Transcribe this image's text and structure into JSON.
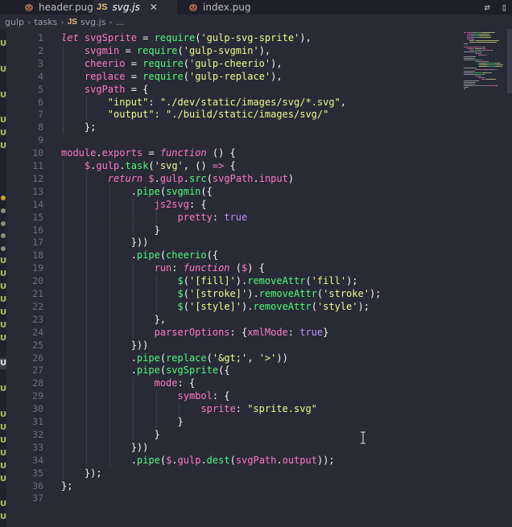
{
  "tabs": [
    {
      "icon": "pug-icon",
      "label": "header.pug",
      "active": false
    },
    {
      "icon": "js-icon",
      "label": "svg.js",
      "active": true
    },
    {
      "icon": "pug-icon",
      "label": "index.pug",
      "active": false
    }
  ],
  "js_icon_text": "JS",
  "breadcrumb": [
    "gulp",
    "tasks",
    "svg.js",
    "..."
  ],
  "editor": {
    "lines": [
      {
        "n": "1",
        "t": [
          [
            "kw",
            "let"
          ],
          [
            "plain",
            " "
          ],
          [
            "id",
            "svgSprite"
          ],
          [
            "plain",
            " = "
          ],
          [
            "fn",
            "require"
          ],
          [
            "plain",
            "("
          ],
          [
            "str",
            "'gulp-svg-sprite'"
          ],
          [
            "plain",
            "),"
          ]
        ]
      },
      {
        "n": "2",
        "t": [
          [
            "plain",
            "    "
          ],
          [
            "id",
            "svgmin"
          ],
          [
            "plain",
            " = "
          ],
          [
            "fn",
            "require"
          ],
          [
            "plain",
            "("
          ],
          [
            "str",
            "'gulp-svgmin'"
          ],
          [
            "plain",
            "),"
          ]
        ]
      },
      {
        "n": "3",
        "t": [
          [
            "plain",
            "    "
          ],
          [
            "id",
            "cheerio"
          ],
          [
            "plain",
            " = "
          ],
          [
            "fn",
            "require"
          ],
          [
            "plain",
            "("
          ],
          [
            "str",
            "'gulp-cheerio'"
          ],
          [
            "plain",
            "),"
          ]
        ]
      },
      {
        "n": "4",
        "t": [
          [
            "plain",
            "    "
          ],
          [
            "id",
            "replace"
          ],
          [
            "plain",
            " = "
          ],
          [
            "fn",
            "require"
          ],
          [
            "plain",
            "("
          ],
          [
            "str",
            "'gulp-replace'"
          ],
          [
            "plain",
            "),"
          ]
        ]
      },
      {
        "n": "5",
        "t": [
          [
            "plain",
            "    "
          ],
          [
            "id",
            "svgPath"
          ],
          [
            "plain",
            " = {"
          ]
        ]
      },
      {
        "n": "6",
        "t": [
          [
            "plain",
            "        "
          ],
          [
            "str",
            "\"input\""
          ],
          [
            "plain",
            ": "
          ],
          [
            "str",
            "\"./dev/static/images/svg/*.svg\""
          ],
          [
            "plain",
            ","
          ]
        ]
      },
      {
        "n": "7",
        "t": [
          [
            "plain",
            "        "
          ],
          [
            "str",
            "\"output\""
          ],
          [
            "plain",
            ": "
          ],
          [
            "str",
            "\"./build/static/images/svg/\""
          ]
        ]
      },
      {
        "n": "8",
        "t": [
          [
            "plain",
            "    };"
          ]
        ]
      },
      {
        "n": "9",
        "t": []
      },
      {
        "n": "10",
        "t": [
          [
            "id",
            "module"
          ],
          [
            "plain",
            "."
          ],
          [
            "id",
            "exports"
          ],
          [
            "plain",
            " = "
          ],
          [
            "kw",
            "function"
          ],
          [
            "plain",
            " () {"
          ]
        ]
      },
      {
        "n": "11",
        "t": [
          [
            "plain",
            "    "
          ],
          [
            "id",
            "$"
          ],
          [
            "plain",
            "."
          ],
          [
            "id",
            "gulp"
          ],
          [
            "plain",
            "."
          ],
          [
            "fn",
            "task"
          ],
          [
            "plain",
            "("
          ],
          [
            "str",
            "'svg'"
          ],
          [
            "plain",
            ", () "
          ],
          [
            "kw",
            "=>"
          ],
          [
            "plain",
            " {"
          ]
        ]
      },
      {
        "n": "12",
        "t": [
          [
            "plain",
            "        "
          ],
          [
            "kw",
            "return"
          ],
          [
            "plain",
            " "
          ],
          [
            "id",
            "$"
          ],
          [
            "plain",
            "."
          ],
          [
            "id",
            "gulp"
          ],
          [
            "plain",
            "."
          ],
          [
            "fn",
            "src"
          ],
          [
            "plain",
            "("
          ],
          [
            "id",
            "svgPath"
          ],
          [
            "plain",
            "."
          ],
          [
            "id",
            "input"
          ],
          [
            "plain",
            ")"
          ]
        ]
      },
      {
        "n": "13",
        "t": [
          [
            "plain",
            "            ."
          ],
          [
            "fn",
            "pipe"
          ],
          [
            "plain",
            "("
          ],
          [
            "fn",
            "svgmin"
          ],
          [
            "plain",
            "({"
          ]
        ]
      },
      {
        "n": "14",
        "t": [
          [
            "plain",
            "                "
          ],
          [
            "prop",
            "js2svg"
          ],
          [
            "plain",
            ": {"
          ]
        ]
      },
      {
        "n": "15",
        "t": [
          [
            "plain",
            "                    "
          ],
          [
            "prop",
            "pretty"
          ],
          [
            "plain",
            ": "
          ],
          [
            "bool",
            "true"
          ]
        ]
      },
      {
        "n": "16",
        "t": [
          [
            "plain",
            "                }"
          ]
        ]
      },
      {
        "n": "17",
        "t": [
          [
            "plain",
            "            }))"
          ]
        ]
      },
      {
        "n": "18",
        "t": [
          [
            "plain",
            "            ."
          ],
          [
            "fn",
            "pipe"
          ],
          [
            "plain",
            "("
          ],
          [
            "fn",
            "cheerio"
          ],
          [
            "plain",
            "({"
          ]
        ]
      },
      {
        "n": "19",
        "t": [
          [
            "plain",
            "                "
          ],
          [
            "prop",
            "run"
          ],
          [
            "plain",
            ": "
          ],
          [
            "kw",
            "function"
          ],
          [
            "plain",
            " ("
          ],
          [
            "id",
            "$"
          ],
          [
            "plain",
            ") {"
          ]
        ]
      },
      {
        "n": "20",
        "t": [
          [
            "plain",
            "                    "
          ],
          [
            "fn",
            "$"
          ],
          [
            "plain",
            "("
          ],
          [
            "str",
            "'[fill]'"
          ],
          [
            "plain",
            ")."
          ],
          [
            "fn",
            "removeAttr"
          ],
          [
            "plain",
            "("
          ],
          [
            "str",
            "'fill'"
          ],
          [
            "plain",
            ");"
          ]
        ]
      },
      {
        "n": "21",
        "t": [
          [
            "plain",
            "                    "
          ],
          [
            "fn",
            "$"
          ],
          [
            "plain",
            "("
          ],
          [
            "str",
            "'[stroke]'"
          ],
          [
            "plain",
            ")."
          ],
          [
            "fn",
            "removeAttr"
          ],
          [
            "plain",
            "("
          ],
          [
            "str",
            "'stroke'"
          ],
          [
            "plain",
            ");"
          ]
        ]
      },
      {
        "n": "22",
        "t": [
          [
            "plain",
            "                    "
          ],
          [
            "fn",
            "$"
          ],
          [
            "plain",
            "("
          ],
          [
            "str",
            "'[style]'"
          ],
          [
            "plain",
            ")."
          ],
          [
            "fn",
            "removeAttr"
          ],
          [
            "plain",
            "("
          ],
          [
            "str",
            "'style'"
          ],
          [
            "plain",
            ");"
          ]
        ]
      },
      {
        "n": "23",
        "t": [
          [
            "plain",
            "                },"
          ]
        ]
      },
      {
        "n": "24",
        "t": [
          [
            "plain",
            "                "
          ],
          [
            "prop",
            "parserOptions"
          ],
          [
            "plain",
            ": {"
          ],
          [
            "prop",
            "xmlMode"
          ],
          [
            "plain",
            ": "
          ],
          [
            "bool",
            "true"
          ],
          [
            "plain",
            "}"
          ]
        ]
      },
      {
        "n": "25",
        "t": [
          [
            "plain",
            "            }))"
          ]
        ]
      },
      {
        "n": "26",
        "t": [
          [
            "plain",
            "            ."
          ],
          [
            "fn",
            "pipe"
          ],
          [
            "plain",
            "("
          ],
          [
            "fn",
            "replace"
          ],
          [
            "plain",
            "("
          ],
          [
            "str",
            "'&gt;'"
          ],
          [
            "plain",
            ", "
          ],
          [
            "str",
            "'>'"
          ],
          [
            "plain",
            "))"
          ]
        ]
      },
      {
        "n": "27",
        "t": [
          [
            "plain",
            "            ."
          ],
          [
            "fn",
            "pipe"
          ],
          [
            "plain",
            "("
          ],
          [
            "fn",
            "svgSprite"
          ],
          [
            "plain",
            "({"
          ]
        ]
      },
      {
        "n": "28",
        "t": [
          [
            "plain",
            "                "
          ],
          [
            "prop",
            "mode"
          ],
          [
            "plain",
            ": {"
          ]
        ]
      },
      {
        "n": "29",
        "t": [
          [
            "plain",
            "                    "
          ],
          [
            "prop",
            "symbol"
          ],
          [
            "plain",
            ": {"
          ]
        ]
      },
      {
        "n": "30",
        "t": [
          [
            "plain",
            "                        "
          ],
          [
            "prop",
            "sprite"
          ],
          [
            "plain",
            ": "
          ],
          [
            "str",
            "\"sprite.svg\""
          ]
        ]
      },
      {
        "n": "31",
        "t": [
          [
            "plain",
            "                    }"
          ]
        ]
      },
      {
        "n": "32",
        "t": [
          [
            "plain",
            "                }"
          ]
        ]
      },
      {
        "n": "33",
        "t": [
          [
            "plain",
            "            }))"
          ]
        ]
      },
      {
        "n": "34",
        "t": [
          [
            "plain",
            "            ."
          ],
          [
            "fn",
            "pipe"
          ],
          [
            "plain",
            "("
          ],
          [
            "id",
            "$"
          ],
          [
            "plain",
            "."
          ],
          [
            "id",
            "gulp"
          ],
          [
            "plain",
            "."
          ],
          [
            "fn",
            "dest"
          ],
          [
            "plain",
            "("
          ],
          [
            "id",
            "svgPath"
          ],
          [
            "plain",
            "."
          ],
          [
            "id",
            "output"
          ],
          [
            "plain",
            "));"
          ]
        ]
      },
      {
        "n": "35",
        "t": [
          [
            "plain",
            "    });"
          ]
        ]
      },
      {
        "n": "36",
        "t": [
          [
            "plain",
            "};"
          ]
        ]
      },
      {
        "n": "37",
        "t": []
      }
    ]
  },
  "git_markers": [
    {
      "row": 1,
      "kind": "u",
      "label": "U"
    },
    {
      "row": 3,
      "kind": "u",
      "label": "U"
    },
    {
      "row": 5,
      "kind": "u",
      "label": "U"
    },
    {
      "row": 7,
      "kind": "u",
      "label": "U"
    },
    {
      "row": 8,
      "kind": "u",
      "label": "U"
    },
    {
      "row": 9,
      "kind": "u",
      "label": "U"
    },
    {
      "row": 13,
      "kind": "dot-yellow",
      "label": ""
    },
    {
      "row": 14,
      "kind": "dot",
      "label": ""
    },
    {
      "row": 15,
      "kind": "dot",
      "label": ""
    },
    {
      "row": 16,
      "kind": "dot",
      "label": ""
    },
    {
      "row": 17,
      "kind": "dot",
      "label": ""
    },
    {
      "row": 18,
      "kind": "u",
      "label": "U"
    },
    {
      "row": 19,
      "kind": "u",
      "label": "U"
    },
    {
      "row": 20,
      "kind": "u",
      "label": "U"
    },
    {
      "row": 21,
      "kind": "u",
      "label": "U"
    },
    {
      "row": 22,
      "kind": "u",
      "label": "U"
    },
    {
      "row": 23,
      "kind": "u",
      "label": "U"
    },
    {
      "row": 24,
      "kind": "u",
      "label": "U"
    },
    {
      "row": 26,
      "kind": "hl",
      "label": "U"
    },
    {
      "row": 28,
      "kind": "u",
      "label": "U"
    },
    {
      "row": 30,
      "kind": "u",
      "label": "U"
    },
    {
      "row": 31,
      "kind": "u",
      "label": "U"
    },
    {
      "row": 32,
      "kind": "u",
      "label": "U"
    },
    {
      "row": 33,
      "kind": "u",
      "label": "U"
    },
    {
      "row": 34,
      "kind": "u",
      "label": "U"
    },
    {
      "row": 35,
      "kind": "u",
      "label": "U"
    },
    {
      "row": 37,
      "kind": "u",
      "label": "U"
    },
    {
      "row": 38,
      "kind": "u",
      "label": "U"
    }
  ],
  "colors": {
    "background": "#282a36",
    "keyword": "#ff79c6",
    "function": "#50fa7b",
    "string": "#f1fa8c",
    "boolean": "#bd93f9",
    "git_untracked": "#b5c560"
  }
}
